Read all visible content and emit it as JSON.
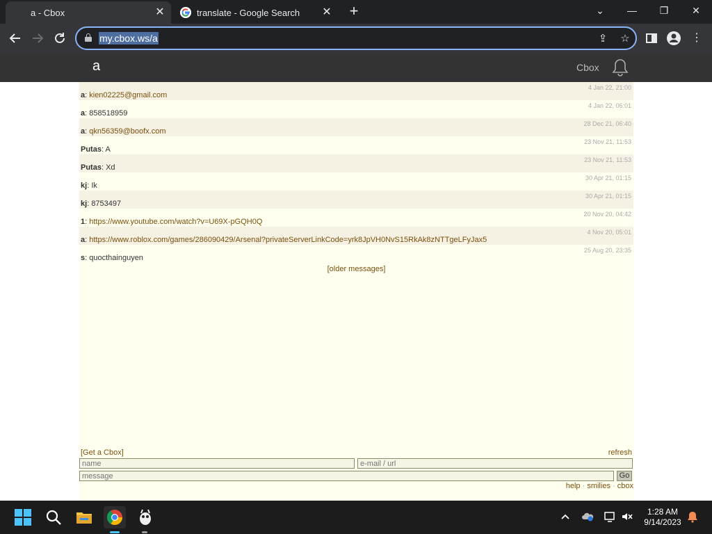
{
  "browser": {
    "tabs": [
      {
        "title": "a - Cbox",
        "active": true
      },
      {
        "title": "translate - Google Search",
        "active": false
      }
    ],
    "address": "my.cbox.ws/a"
  },
  "cbox": {
    "name": "a",
    "brand": "Cbox",
    "messages": [
      {
        "time": "4 Jan 22, 21:00",
        "name": "a",
        "text": "kien02225@gmail.com",
        "link": true
      },
      {
        "time": "4 Jan 22, 06:01",
        "name": "a",
        "text": "858518959",
        "link": false
      },
      {
        "time": "28 Dec 21, 06:40",
        "name": "a",
        "text": "qkn56359@boofx.com",
        "link": true
      },
      {
        "time": "23 Nov 21, 11:53",
        "name": "Putas",
        "text": "A",
        "link": false
      },
      {
        "time": "23 Nov 21, 11:53",
        "name": "Putas",
        "text": "Xd",
        "link": false
      },
      {
        "time": "30 Apr 21, 01:15",
        "name": "kj",
        "text": "Ik",
        "link": false
      },
      {
        "time": "30 Apr 21, 01:15",
        "name": "kj",
        "text": "8753497",
        "link": false
      },
      {
        "time": "20 Nov 20, 04:42",
        "name": "1",
        "text": "https://www.youtube.com/watch?v=U69X-pGQH0Q",
        "link": true
      },
      {
        "time": "4 Nov 20, 05:01",
        "name": "a",
        "text": "https://www.roblox.com/games/286090429/Arsenal?privateServerLinkCode=yrk8JpVH0NvS15RkAk8zNTTgeLFyJax5",
        "link": true
      },
      {
        "time": "25 Aug 20, 23:35",
        "name": "s",
        "text": "quocthainguyen",
        "link": false
      }
    ],
    "older_label": "[older messages]",
    "get_cbox_label": "[Get a Cbox]",
    "refresh_label": "refresh",
    "name_placeholder": "name",
    "email_placeholder": "e-mail / url",
    "message_placeholder": "message",
    "go_label": "Go",
    "footer_links": [
      "help",
      "smilies",
      "cbox"
    ]
  },
  "taskbar": {
    "time": "1:28 AM",
    "date": "9/14/2023"
  }
}
